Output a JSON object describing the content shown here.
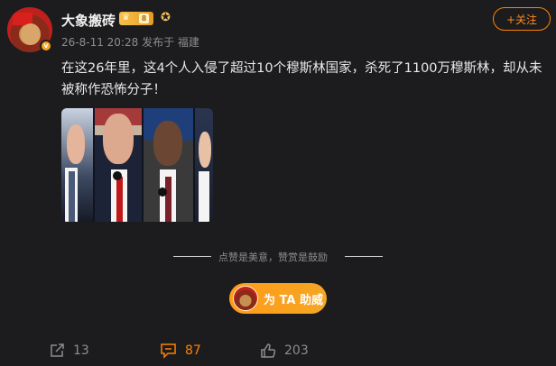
{
  "post": {
    "author": "大象搬砖",
    "level_badge": "8",
    "timestamp": "26-8-11 20:28",
    "posted_from": "发布于 福建",
    "follow_label": "+关注",
    "text": "在这26年里，这4个人入侵了超过10个穆斯林国家，杀死了1100万穆斯林，却从未被称作恐怖分子！"
  },
  "reward": {
    "caption": "点赞是美意，赞赏是鼓励",
    "assist_label": "为 TA 助威"
  },
  "actions": {
    "share_count": "13",
    "comment_count": "87",
    "like_count": "203"
  },
  "colors": {
    "background": "#1c1c1e",
    "accent": "#ff8200",
    "muted_text": "#8d8d8d"
  },
  "icons": {
    "share": "share-icon",
    "comment": "comment-icon",
    "like": "thumbs-up-icon"
  }
}
